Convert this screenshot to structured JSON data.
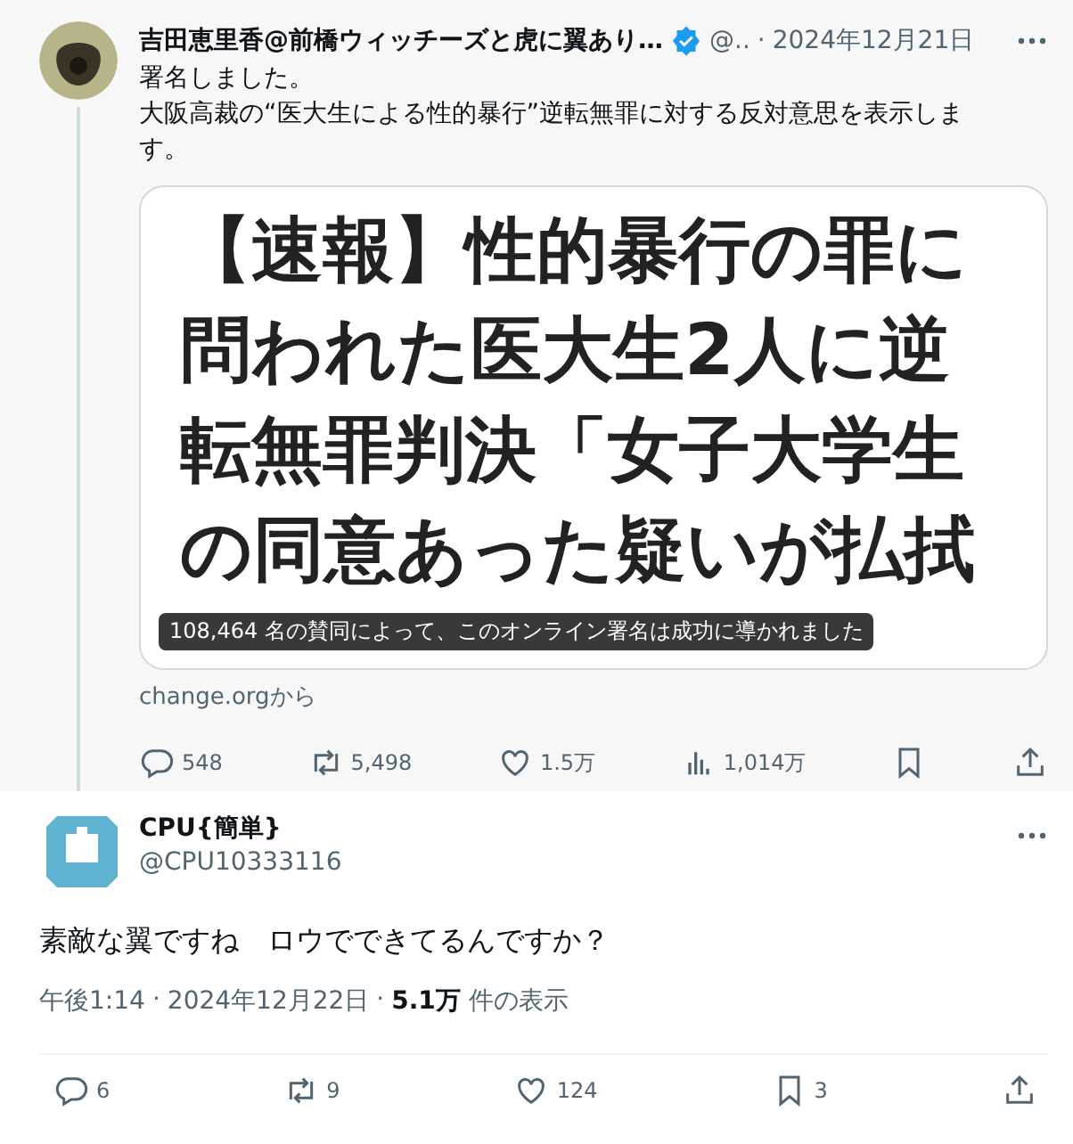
{
  "parent_post": {
    "author": "吉田恵里香@前橋ウィッチーズと虎に翼あり…",
    "verified": true,
    "handle": "@..",
    "separator": "·",
    "date": "2024年12月21日",
    "text_lines": [
      "署名しました。",
      "大阪高裁の“医大生による性的暴行”逆転無罪に対する反対意思を表示します。"
    ],
    "card": {
      "headline_lines": [
        "【速報】性的暴行の罪に",
        "問われた医大生2人に逆",
        "転無罪判決「女子大学生",
        "の同意あった疑いが払拭"
      ],
      "caption": "108,464 名の賛同によって、このオンライン署名は成功に導かれました",
      "source": "change.orgから"
    },
    "actions": [
      {
        "kind": "reply",
        "count": "548"
      },
      {
        "kind": "repost",
        "count": "5,498"
      },
      {
        "kind": "like",
        "count": "1.5万"
      },
      {
        "kind": "views",
        "count": "1,014万"
      },
      {
        "kind": "bookmark"
      },
      {
        "kind": "share"
      }
    ]
  },
  "reply_post": {
    "author": "CPU{簡単}",
    "handle": "@CPU10333116",
    "text": "素敵な翼ですね　ロウでできてるんですか？",
    "time": "午後1:14",
    "separator": "·",
    "date": "2024年12月22日",
    "views_count": "5.1万",
    "views_label": "件の表示",
    "actions": [
      {
        "kind": "reply",
        "count": "6"
      },
      {
        "kind": "repost",
        "count": "9"
      },
      {
        "kind": "like",
        "count": "124"
      },
      {
        "kind": "bookmark",
        "count": "3"
      },
      {
        "kind": "share"
      }
    ]
  }
}
